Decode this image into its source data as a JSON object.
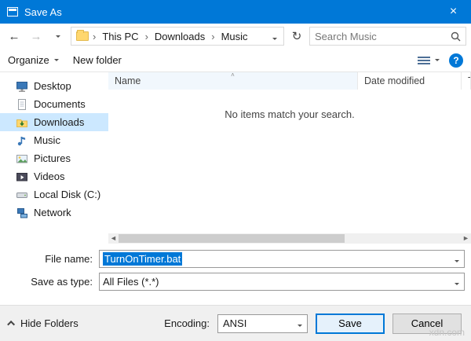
{
  "window": {
    "title": "Save As",
    "close_glyph": "×"
  },
  "nav": {
    "back_glyph": "←",
    "forward_glyph": "→",
    "refresh_glyph": "↻",
    "breadcrumb": [
      "This PC",
      "Downloads",
      "Music"
    ],
    "search_placeholder": "Search Music"
  },
  "toolbar": {
    "organize_label": "Organize",
    "new_folder_label": "New folder",
    "help_glyph": "?"
  },
  "sidebar": {
    "items": [
      {
        "label": "Desktop",
        "icon": "desktop-icon"
      },
      {
        "label": "Documents",
        "icon": "document-icon"
      },
      {
        "label": "Downloads",
        "icon": "downloads-folder-icon",
        "selected": true
      },
      {
        "label": "Music",
        "icon": "music-note-icon"
      },
      {
        "label": "Pictures",
        "icon": "picture-icon"
      },
      {
        "label": "Videos",
        "icon": "video-icon"
      },
      {
        "label": "Local Disk (C:)",
        "icon": "disk-drive-icon"
      },
      {
        "label": "Network",
        "icon": "network-icon"
      }
    ]
  },
  "filelist": {
    "columns": [
      "Name",
      "Date modified",
      "T"
    ],
    "sort_glyph": "˄",
    "empty_message": "No items match your search.",
    "hscroll_left_glyph": "◄",
    "hscroll_right_glyph": "►"
  },
  "fields": {
    "file_name_label": "File name:",
    "file_name_value": "TurnOnTimer.bat",
    "save_as_type_label": "Save as type:",
    "save_as_type_value": "All Files (*.*)"
  },
  "footer": {
    "hide_folders_label": "Hide Folders",
    "encoding_label": "Encoding:",
    "encoding_value": "ANSI",
    "save_label": "Save",
    "cancel_label": "Cancel"
  },
  "watermark": "xdn.com",
  "colors": {
    "titlebar": "#0078d7",
    "accent": "#0078d7",
    "selection": "#cce8ff"
  }
}
